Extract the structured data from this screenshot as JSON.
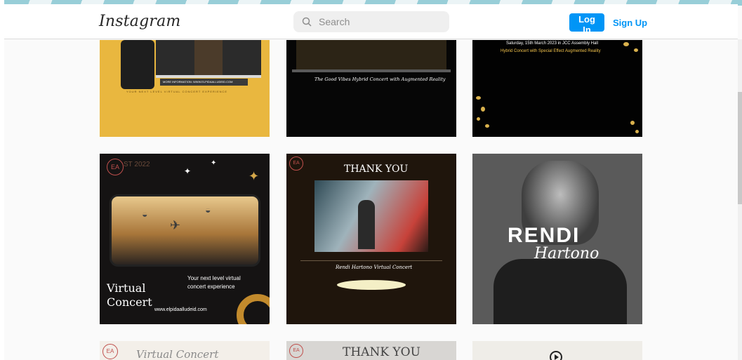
{
  "header": {
    "logo": "Instagram",
    "search_placeholder": "Search",
    "login_label": "Log In",
    "signup_label": "Sign Up"
  },
  "posts": [
    {
      "caption_line": "MORE INFORMATION: WWW.ELPIDAALLUDEID.COM",
      "tagline": "YOUR NEXT LEVEL VIRTUAL CONCERT EXPERIENCE"
    },
    {
      "caption_line": "The Good Vibes Hybrid Concert with Augmented Reality"
    },
    {
      "date_line": "Saturday, 15th March 2023 in JCC Assembly Hall",
      "title_line": "Hybrid Concert with Special Effect Augmented Reality"
    },
    {
      "badge": "EA",
      "year": "ST 2022",
      "headline": "Virtual Concert",
      "subtitle": "Your next level virtual concert experience",
      "website": "www.elpidaalludeid.com"
    },
    {
      "badge": "EA",
      "heading": "THANK YOU",
      "caption": "Rendi Hartono Virtual Concert"
    },
    {
      "name": "RENDI",
      "surname": "Hartono"
    },
    {
      "badge": "EA",
      "title": "Virtual Concert Organizer"
    },
    {
      "badge": "EA",
      "heading": "THANK YOU"
    },
    {
      "icon": "play-icon"
    }
  ],
  "colors": {
    "accent": "#0095f6",
    "gold": "#e9b73f"
  }
}
